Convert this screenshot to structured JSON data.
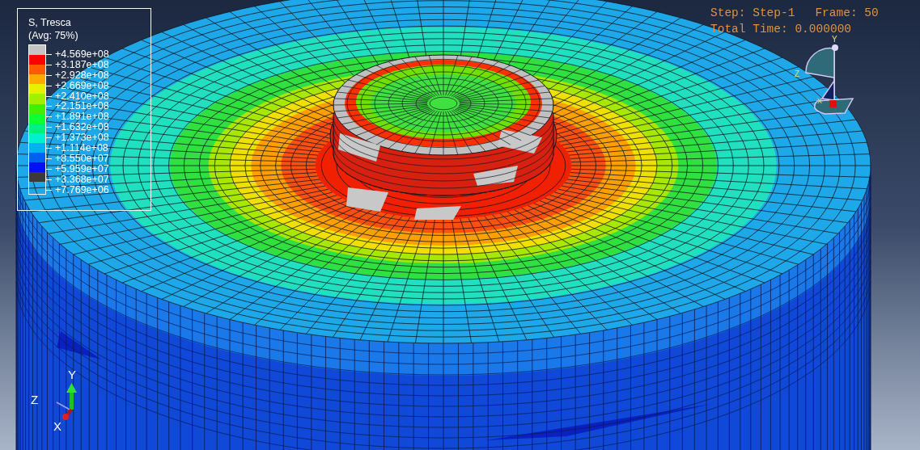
{
  "legend": {
    "title": "S, Tresca",
    "subtitle": "(Avg: 75%)",
    "bands": [
      {
        "color": "#c4c4c4"
      },
      {
        "color": "#ff0000"
      },
      {
        "color": "#ff5a00"
      },
      {
        "color": "#ffaa00"
      },
      {
        "color": "#e8f000"
      },
      {
        "color": "#a0f000"
      },
      {
        "color": "#40f000"
      },
      {
        "color": "#10ff30"
      },
      {
        "color": "#00f080"
      },
      {
        "color": "#00f0d0"
      },
      {
        "color": "#00b0f0"
      },
      {
        "color": "#0060f0"
      },
      {
        "color": "#0010f0"
      },
      {
        "color": "#3a3a3a"
      }
    ],
    "ticks": [
      "+4.569e+08",
      "+3.187e+08",
      "+2.928e+08",
      "+2.669e+08",
      "+2.410e+08",
      "+2.151e+08",
      "+1.891e+08",
      "+1.632e+08",
      "+1.373e+08",
      "+1.114e+08",
      "+8.550e+07",
      "+5.959e+07",
      "+3.368e+07",
      "+7.769e+06"
    ]
  },
  "state_block": {
    "step_label": "Step: Step-1",
    "frame_label": "Frame: 50",
    "time_label": "Total Time: 0.000000"
  },
  "view_cube_axes": [
    "Y",
    "Z",
    "X"
  ],
  "triad_axes": [
    "Y",
    "Z",
    "X"
  ]
}
